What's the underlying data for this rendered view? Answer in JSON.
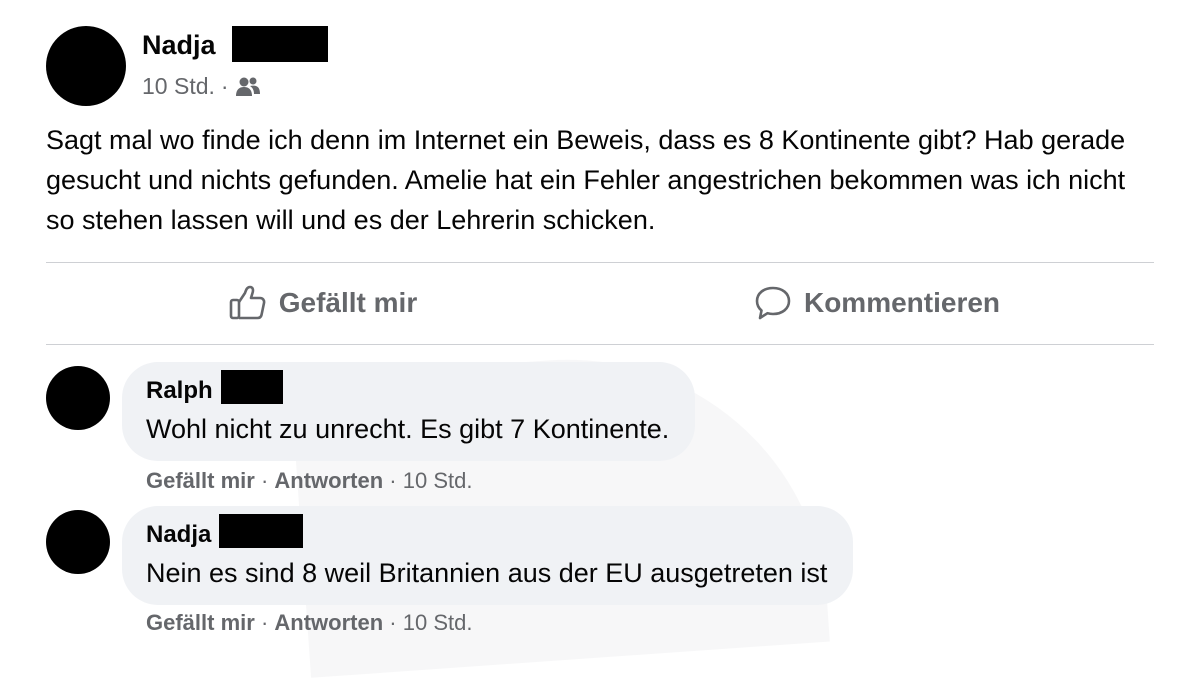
{
  "post": {
    "author": "Nadja",
    "time": "10 Std.",
    "separator": "·",
    "audience_icon": "friends-icon",
    "text": "Sagt mal wo finde ich denn im Internet ein Beweis, dass es 8 Kontinente gibt? Hab gerade gesucht und nichts gefunden. Amelie hat ein Fehler angestrichen bekommen was ich nicht so stehen lassen will und es der Lehrerin schicken."
  },
  "actions": {
    "like_label": "Gefällt mir",
    "like_icon": "thumbs-up-icon",
    "comment_label": "Kommentieren",
    "comment_icon": "speech-bubble-icon"
  },
  "comments": [
    {
      "author": "Ralph",
      "text": "Wohl nicht zu unrecht. Es gibt 7 Kontinente.",
      "like": "Gefällt mir",
      "reply": "Antworten",
      "time": "10 Std.",
      "sep": "·"
    },
    {
      "author": "Nadja",
      "text": "Nein es sind 8 weil Britannien aus der EU ausgetreten ist",
      "like": "Gefällt mir",
      "reply": "Antworten",
      "time": "10 Std.",
      "sep": "·"
    }
  ],
  "colors": {
    "text": "#050505",
    "secondary": "#65676b",
    "bubble": "#f0f2f5",
    "divider": "#ced0d4",
    "redaction": "#000000"
  }
}
